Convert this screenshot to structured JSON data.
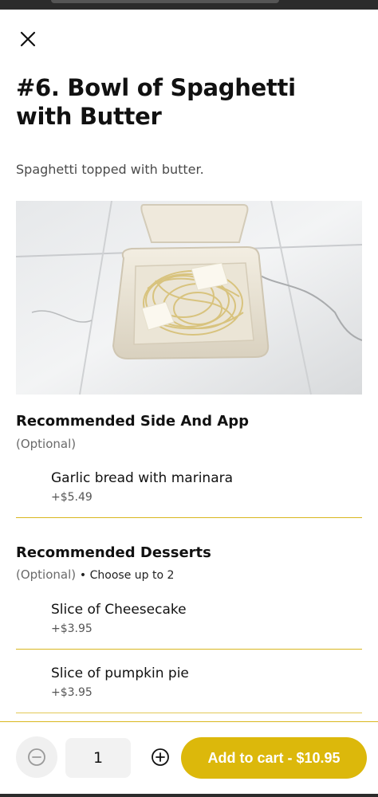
{
  "item": {
    "title": "#6. Bowl of Spaghetti with Butter",
    "description": "Spaghetti topped with butter.",
    "photo_icon": "spaghetti-bowl-photo"
  },
  "sections": [
    {
      "title": "Recommended Side And App",
      "optional": "(Optional)",
      "choose": "",
      "options": [
        {
          "name": "Garlic bread with marinara",
          "price": "+$5.49"
        }
      ]
    },
    {
      "title": "Recommended Desserts",
      "optional": "(Optional)",
      "choose": "• Choose up to 2",
      "options": [
        {
          "name": "Slice of Cheesecake",
          "price": "+$3.95"
        },
        {
          "name": "Slice of pumpkin pie",
          "price": "+$3.95"
        }
      ]
    }
  ],
  "footer": {
    "quantity": "1",
    "add_label": "Add to cart - $10.95",
    "minus_icon": "minus-circle-icon",
    "plus_icon": "plus-circle-icon"
  },
  "colors": {
    "accent": "#dcb80b",
    "divider": "#d9b71f"
  },
  "icons": {
    "close": "close-icon"
  }
}
